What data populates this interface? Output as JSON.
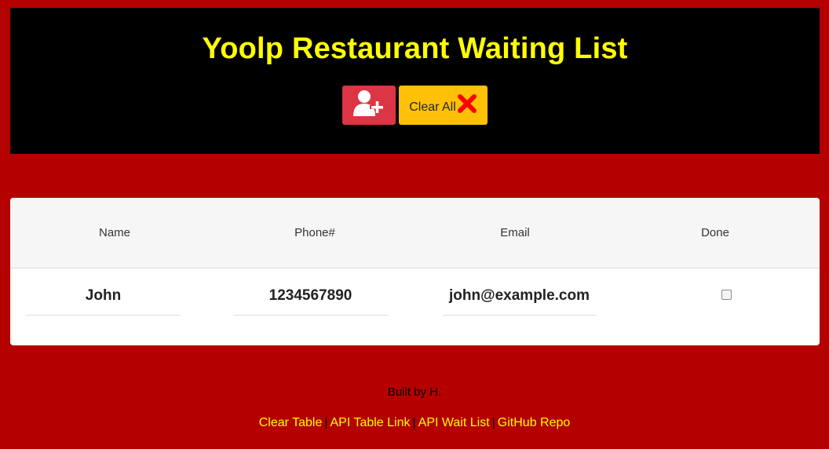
{
  "header": {
    "title": "Yoolp Restaurant Waiting List",
    "add_button_icon": "add-user-icon",
    "clear_all_label": "Clear All",
    "clear_all_icon": "close-x-icon"
  },
  "table": {
    "columns": [
      "Name",
      "Phone#",
      "Email",
      "Done"
    ],
    "rows": [
      {
        "name": "John",
        "phone": "1234567890",
        "email": "john@example.com",
        "done": false
      }
    ]
  },
  "footer": {
    "built_by": "Built by H.",
    "links": [
      "Clear Table",
      "API Table Link",
      "API Wait List",
      "GitHub Repo"
    ],
    "separator": "|"
  },
  "colors": {
    "page_background": "#b50000",
    "header_background": "#000000",
    "title_color": "#ffff00",
    "add_button": "#dc3545",
    "clear_button": "#ffc107",
    "link_color": "#ffff00"
  }
}
